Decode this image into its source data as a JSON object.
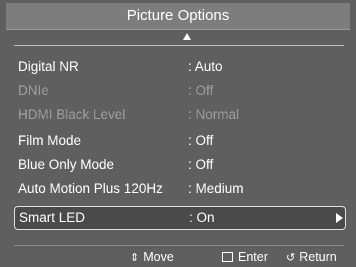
{
  "title": "Picture Options",
  "menu": [
    {
      "label": "Digital NR",
      "value": ": Auto",
      "disabled": false
    },
    {
      "label": "DNIe",
      "value": ": Off",
      "disabled": true
    },
    {
      "label": "HDMI Black Level",
      "value": ": Normal",
      "disabled": true
    },
    {
      "label": "Film Mode",
      "value": ": Off",
      "disabled": false
    },
    {
      "label": "Blue Only Mode",
      "value": ": Off",
      "disabled": false
    },
    {
      "label": "Auto Motion Plus 120Hz",
      "value": ": Medium",
      "disabled": false
    },
    {
      "label": "Smart LED",
      "value": ": On",
      "disabled": false,
      "selected": true
    }
  ],
  "footer": {
    "move": "Move",
    "enter": "Enter",
    "return": "Return"
  },
  "icons": {
    "scroll_up": "triangle-up-icon",
    "submenu": "triangle-right-icon",
    "move": "updown-arrow-icon",
    "enter": "enter-icon",
    "return": "return-icon"
  }
}
